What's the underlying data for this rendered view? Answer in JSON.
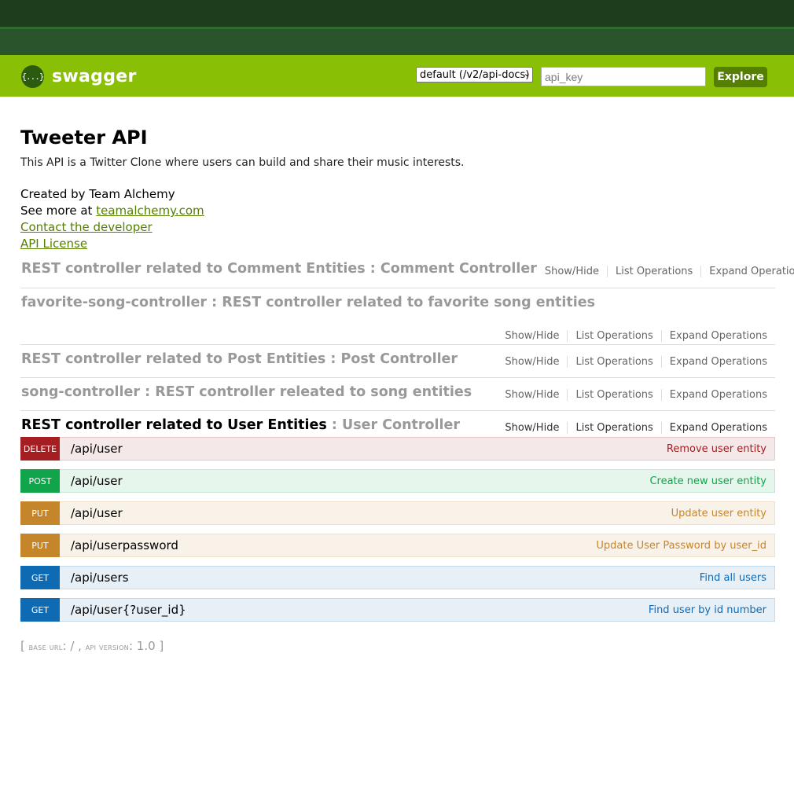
{
  "header": {
    "logo_glyph": "{...}",
    "logo_text": "swagger",
    "spec_select_value": "default (/v2/api-docs)",
    "api_key_placeholder": "api_key",
    "explore_label": "Explore",
    "colors": {
      "top_band": "#1e3d1c",
      "header_bg": "#89bf04",
      "explore_bg": "#547f00"
    }
  },
  "info": {
    "title": "Tweeter API",
    "description": "This API is a Twitter Clone where users can build and share their music interests.",
    "created_by": "Created by Team Alchemy",
    "see_more_prefix": "See more at ",
    "see_more_link": "teamalchemy.com",
    "contact_link": "Contact the developer",
    "license_link": "API License"
  },
  "resource_links": {
    "show_hide": "Show/Hide",
    "list_ops": "List Operations",
    "expand_ops": "Expand Operations"
  },
  "resources": [
    {
      "title": "REST controller related to Comment Entities : Comment Controller"
    },
    {
      "title": "favorite-song-controller : REST controller related to favorite song entities"
    },
    {
      "title": "REST controller related to Post Entities : Post Controller"
    },
    {
      "title": "song-controller : REST controller releated to song entities"
    },
    {
      "title_main": "REST controller related to User Entities",
      "title_sub": " : User Controller"
    }
  ],
  "operations": [
    {
      "method": "DELETE",
      "path": "/api/user",
      "summary": "Remove user entity"
    },
    {
      "method": "POST",
      "path": "/api/user",
      "summary": "Create new user entity"
    },
    {
      "method": "PUT",
      "path": "/api/user",
      "summary": "Update user entity"
    },
    {
      "method": "PUT",
      "path": "/api/userpassword",
      "summary": "Update User Password by user_id"
    },
    {
      "method": "GET",
      "path": "/api/users",
      "summary": "Find all users"
    },
    {
      "method": "GET",
      "path": "/api/user{?user_id}",
      "summary": "Find user by id number"
    }
  ],
  "footer": {
    "open_bracket": "[ ",
    "base_url_label": "base url",
    "base_url_value": ": / , ",
    "api_version_label": "api version",
    "api_version_value": ": 1.0 ]"
  }
}
